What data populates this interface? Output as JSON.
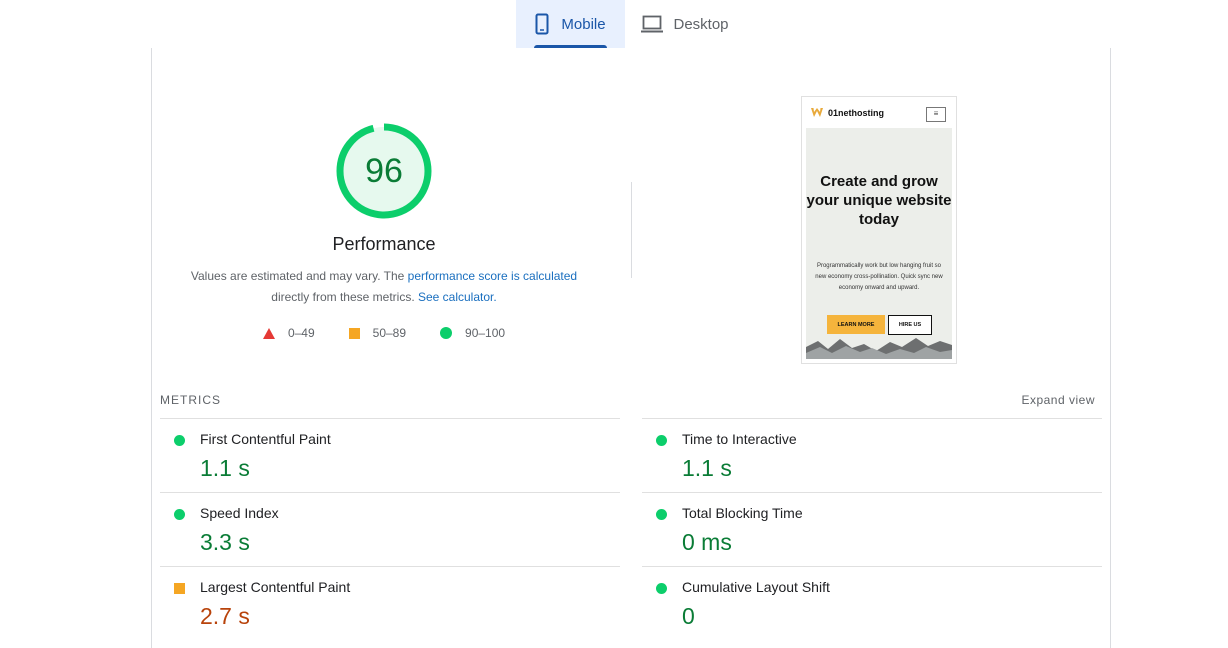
{
  "tabs": [
    {
      "label": "Mobile",
      "icon": "phone-icon",
      "active": true
    },
    {
      "label": "Desktop",
      "icon": "laptop-icon",
      "active": false
    }
  ],
  "score": {
    "value": "96",
    "fraction": 0.96,
    "title": "Performance",
    "desc_prefix": "Values are estimated and may vary. The ",
    "desc_link1": "performance score is calculated",
    "desc_mid": "directly from these metrics. ",
    "desc_link2": "See calculator."
  },
  "legend": [
    {
      "icon": "triangle-icon",
      "label": "0–49",
      "color": "#e53935"
    },
    {
      "icon": "square-icon",
      "label": "50–89",
      "color": "#f5a623"
    },
    {
      "icon": "circle-icon",
      "label": "90–100",
      "color": "#0cce6b"
    }
  ],
  "preview": {
    "brand": "01nethosting",
    "menu_glyph": "≡",
    "headline": "Create and grow your unique website today",
    "body": "Programmatically work but low hanging fruit so new economy cross-pollination. Quick sync new economy onward and upward.",
    "btn_primary": "LEARN MORE",
    "btn_secondary": "HIRE US"
  },
  "metrics": {
    "heading": "METRICS",
    "expand_label": "Expand view",
    "items": [
      {
        "name": "First Contentful Paint",
        "value": "1.1 s",
        "status": "good"
      },
      {
        "name": "Time to Interactive",
        "value": "1.1 s",
        "status": "good"
      },
      {
        "name": "Speed Index",
        "value": "3.3 s",
        "status": "good"
      },
      {
        "name": "Total Blocking Time",
        "value": "0 ms",
        "status": "good"
      },
      {
        "name": "Largest Contentful Paint",
        "value": "2.7 s",
        "status": "average"
      },
      {
        "name": "Cumulative Layout Shift",
        "value": "0",
        "status": "good"
      }
    ]
  },
  "colors": {
    "good": "#0cce6b",
    "good_text": "#0a7c36",
    "average": "#f5a623",
    "average_text": "#b8430b",
    "accent": "#1a56a8"
  }
}
